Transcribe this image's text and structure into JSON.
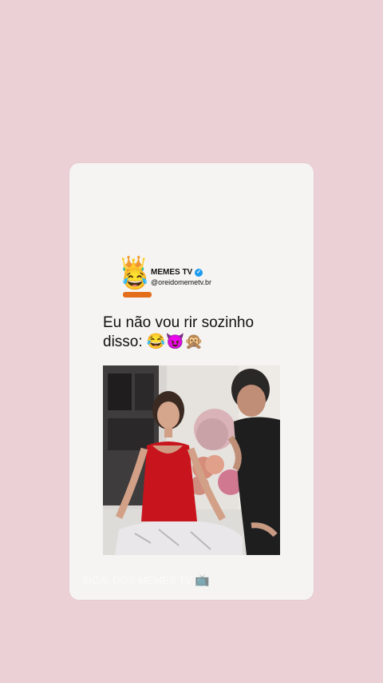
{
  "post": {
    "channel_name": "MEMES TV",
    "verified_mark": "✓",
    "handle": "@oreidomemetv.br",
    "caption_line1": "Eu não vou rir sozinho",
    "caption_line2": "disso: 😂😈🙊",
    "footer_text": "SIGA: DOS MEMES TV",
    "footer_icon": "📺",
    "avatar_emoji": "😂",
    "avatar_crown": "👑"
  },
  "colors": {
    "background": "#ebd0d6",
    "card": "#f5f4f2",
    "verified": "#1d9bf0",
    "dress": "#c8141c"
  },
  "icons": [
    "crown-icon",
    "laughing-emoji-icon",
    "verified-icon",
    "tv-icon"
  ]
}
